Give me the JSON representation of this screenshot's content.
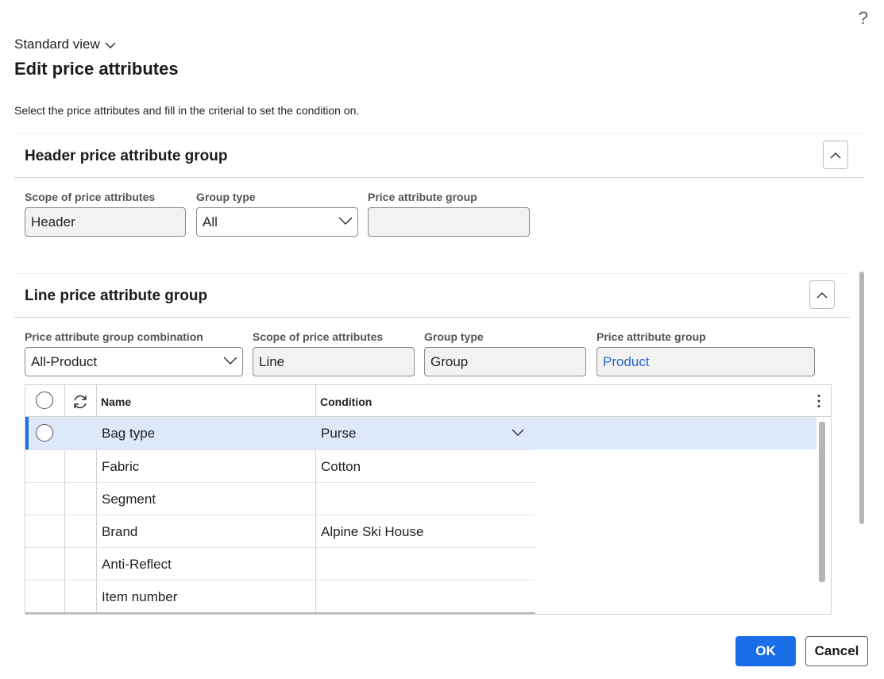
{
  "help_icon": "?",
  "view_selector": {
    "label": "Standard view"
  },
  "title": "Edit price attributes",
  "instructions": "Select the price attributes and fill in the criterial to set the condition on.",
  "header_group": {
    "title": "Header price attribute group",
    "scope_label": "Scope of price attributes",
    "scope_value": "Header",
    "group_type_label": "Group type",
    "group_type_value": "All",
    "price_group_label": "Price attribute group",
    "price_group_value": ""
  },
  "line_group": {
    "title": "Line price attribute group",
    "combination_label": "Price attribute group combination",
    "combination_value": "All-Product",
    "scope_label": "Scope of price attributes",
    "scope_value": "Line",
    "group_type_label": "Group type",
    "group_type_value": "Group",
    "price_group_label": "Price attribute group",
    "price_group_value": "Product"
  },
  "grid": {
    "columns": [
      "Name",
      "Condition"
    ],
    "rows": [
      {
        "name": "Bag type",
        "condition": "Purse",
        "selected": true
      },
      {
        "name": "Fabric",
        "condition": "Cotton",
        "selected": false
      },
      {
        "name": "Segment",
        "condition": "",
        "selected": false
      },
      {
        "name": "Brand",
        "condition": "Alpine Ski House",
        "selected": false
      },
      {
        "name": "Anti-Reflect",
        "condition": "",
        "selected": false
      },
      {
        "name": "Item number",
        "condition": "",
        "selected": false
      }
    ]
  },
  "buttons": {
    "ok": "OK",
    "cancel": "Cancel"
  },
  "icons": [
    "question-icon",
    "chevron-down-icon",
    "chevron-up-icon",
    "refresh-icon",
    "more-vertical-icon",
    "radio-icon"
  ],
  "colors": {
    "primary": "#1a6ee8",
    "selected_row": "#dde8f9",
    "link": "#2266d6"
  }
}
